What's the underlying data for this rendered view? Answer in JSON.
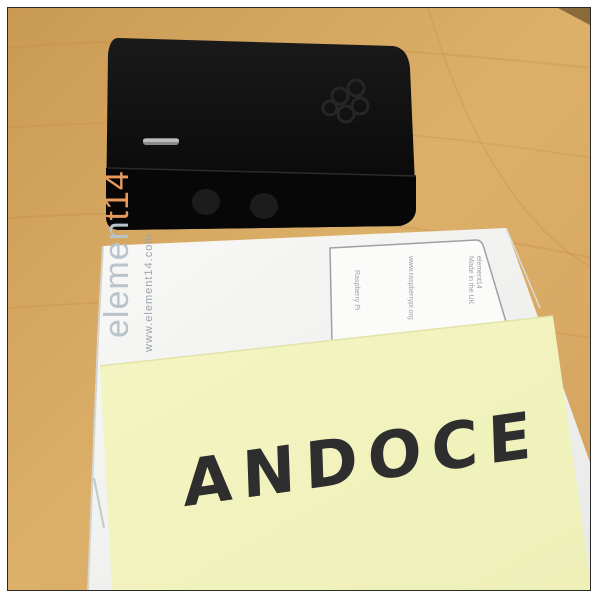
{
  "scene": {
    "background_color": "#d9a961",
    "device_color": "#0d0d0d",
    "box_color": "#f7f7f5",
    "note_color": "#f5f6c6"
  },
  "box": {
    "brand_prefix": "elemen",
    "brand_suffix": "t14",
    "url": "www.element14.com",
    "card_label": "Raspberry Pi",
    "card_url": "www.raspberrypi.org",
    "card_brand": "element14",
    "card_made": "Made in the UK"
  },
  "note": {
    "handwriting": "ANDOCE"
  },
  "icons": {
    "logo": "raspberry-pi-logo-icon"
  }
}
